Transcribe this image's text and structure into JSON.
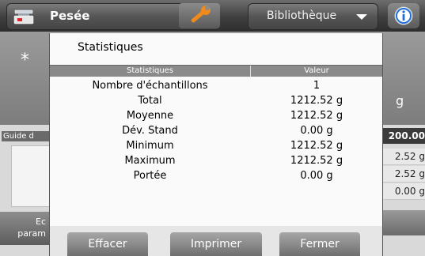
{
  "topbar": {
    "app_label": "Pesée",
    "library_label": "Bibliothèque"
  },
  "main": {
    "star": "*",
    "unit": "g",
    "guide_label": "Guide d",
    "param_line1": "Ec",
    "param_line2": "param",
    "right_column": {
      "top": "200.00",
      "rows": [
        "2.52 g",
        "2.52 g",
        "0.00 g"
      ]
    }
  },
  "dialog": {
    "title": "Statistiques",
    "columns": [
      "Statistiques",
      "Valeur"
    ],
    "rows": [
      {
        "label": "Nombre d'échantillons",
        "value": "1"
      },
      {
        "label": "Total",
        "value": "1212.52 g"
      },
      {
        "label": "Moyenne",
        "value": "1212.52 g"
      },
      {
        "label": "Dév. Stand",
        "value": "0.00 g"
      },
      {
        "label": "Minimum",
        "value": "1212.52 g"
      },
      {
        "label": "Maximum",
        "value": "1212.52 g"
      },
      {
        "label": "Portée",
        "value": "0.00 g"
      }
    ],
    "buttons": {
      "clear": "Effacer",
      "print": "Imprimer",
      "close": "Fermer"
    }
  },
  "icons": {
    "app": "scale-icon",
    "wrench": "wrench-icon",
    "info": "info-icon"
  },
  "colors": {
    "accent_red": "#d8262b",
    "wrench_orange": "#f08a1c",
    "info_blue": "#1e6fd9"
  }
}
